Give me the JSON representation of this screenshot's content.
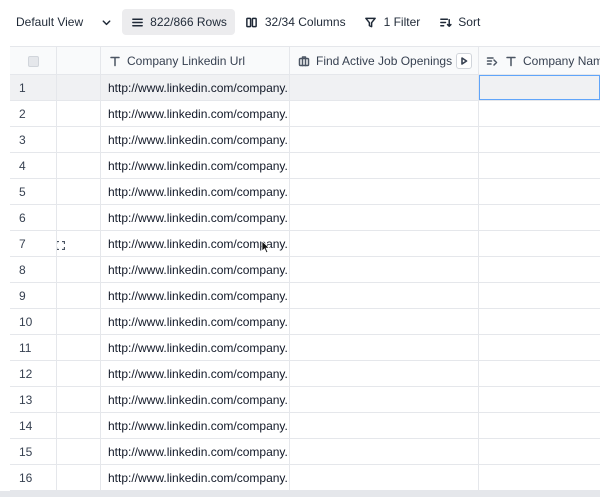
{
  "toolbar": {
    "view_label": "Default View",
    "rows_label": "822/866 Rows",
    "columns_label": "32/34 Columns",
    "filter_label": "1 Filter",
    "sort_label": "Sort"
  },
  "columns": {
    "linkedin": "Company Linkedin Url",
    "jobs": "Find Active Job Openings",
    "name": "Company Name"
  },
  "rows": [
    {
      "num": "1",
      "url": "http://www.linkedin.com/company..."
    },
    {
      "num": "2",
      "url": "http://www.linkedin.com/company..."
    },
    {
      "num": "3",
      "url": "http://www.linkedin.com/company..."
    },
    {
      "num": "4",
      "url": "http://www.linkedin.com/company..."
    },
    {
      "num": "5",
      "url": "http://www.linkedin.com/company..."
    },
    {
      "num": "6",
      "url": "http://www.linkedin.com/company..."
    },
    {
      "num": "7",
      "url": "http://www.linkedin.com/company..."
    },
    {
      "num": "8",
      "url": "http://www.linkedin.com/company..."
    },
    {
      "num": "9",
      "url": "http://www.linkedin.com/company..."
    },
    {
      "num": "10",
      "url": "http://www.linkedin.com/company..."
    },
    {
      "num": "11",
      "url": "http://www.linkedin.com/company..."
    },
    {
      "num": "12",
      "url": "http://www.linkedin.com/company..."
    },
    {
      "num": "13",
      "url": "http://www.linkedin.com/company..."
    },
    {
      "num": "14",
      "url": "http://www.linkedin.com/company..."
    },
    {
      "num": "15",
      "url": "http://www.linkedin.com/company..."
    },
    {
      "num": "16",
      "url": "http://www.linkedin.com/company..."
    }
  ],
  "selected_row": 0,
  "hover_row": 6,
  "colors": {
    "accent": "#60a5fa",
    "border": "#e5e7eb",
    "header_bg": "#f9fafb",
    "selected_row_bg": "#f0f1f3"
  }
}
